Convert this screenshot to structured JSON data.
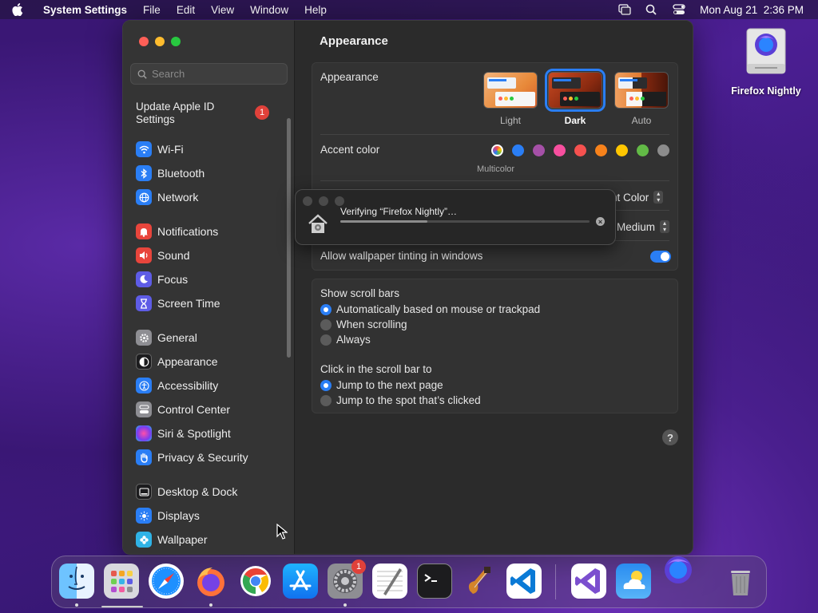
{
  "menubar": {
    "app_name": "System Settings",
    "menus": [
      "File",
      "Edit",
      "View",
      "Window",
      "Help"
    ],
    "datetime": "Mon Aug 21  2:36 PM"
  },
  "window": {
    "search": {
      "placeholder": "Search"
    },
    "sidebar": {
      "apple_id_label": "Update Apple ID Settings",
      "apple_id_badge": "1",
      "items": [
        {
          "label": "Wi-Fi",
          "icon": "wifi-icon",
          "color": "#2a7ef5"
        },
        {
          "label": "Bluetooth",
          "icon": "bluetooth-icon",
          "color": "#2a7ef5"
        },
        {
          "label": "Network",
          "icon": "globe-icon",
          "color": "#2a7ef5"
        },
        {
          "label": "Notifications",
          "icon": "bell-icon",
          "color": "#e8453c"
        },
        {
          "label": "Sound",
          "icon": "speaker-icon",
          "color": "#e8453c"
        },
        {
          "label": "Focus",
          "icon": "moon-icon",
          "color": "#5e5ce6"
        },
        {
          "label": "Screen Time",
          "icon": "hourglass-icon",
          "color": "#5e5ce6"
        },
        {
          "label": "General",
          "icon": "gear-icon",
          "color": "#8e8e93"
        },
        {
          "label": "Appearance",
          "icon": "appearance-icon",
          "color": "#1c1c1e"
        },
        {
          "label": "Accessibility",
          "icon": "accessibility-icon",
          "color": "#2a7ef5"
        },
        {
          "label": "Control Center",
          "icon": "control-center-icon",
          "color": "#8e8e93"
        },
        {
          "label": "Siri & Spotlight",
          "icon": "siri-icon",
          "color": "#b34fd1"
        },
        {
          "label": "Privacy & Security",
          "icon": "hand-icon",
          "color": "#2a7ef5"
        },
        {
          "label": "Desktop & Dock",
          "icon": "dock-icon",
          "color": "#1c1c1e"
        },
        {
          "label": "Displays",
          "icon": "sun-icon",
          "color": "#2a7ef5"
        },
        {
          "label": "Wallpaper",
          "icon": "flower-icon",
          "color": "#2fb3e6"
        }
      ]
    },
    "main": {
      "title": "Appearance",
      "appearance_label": "Appearance",
      "appearance_options": [
        {
          "label": "Light",
          "selected": false
        },
        {
          "label": "Dark",
          "selected": true
        },
        {
          "label": "Auto",
          "selected": false
        }
      ],
      "accent_label": "Accent color",
      "accent_colors": [
        "multicolor",
        "#2a7ef5",
        "#a550a7",
        "#f74f9e",
        "#f5514f",
        "#f7821b",
        "#ffc600",
        "#62ba46",
        "#8c8c8c"
      ],
      "accent_selected_label": "Multicolor",
      "highlight_value": "nt Color",
      "sidebar_icon_size_value": "Medium",
      "wallpaper_tinting_label": "Allow wallpaper tinting in windows",
      "wallpaper_tinting_on": true,
      "scroll_bars_label": "Show scroll bars",
      "scroll_bars_options": [
        {
          "label": "Automatically based on mouse or trackpad",
          "selected": true
        },
        {
          "label": "When scrolling",
          "selected": false
        },
        {
          "label": "Always",
          "selected": false
        }
      ],
      "click_label": "Click in the scroll bar to",
      "click_options": [
        {
          "label": "Jump to the next page",
          "selected": true
        },
        {
          "label": "Jump to the spot that’s clicked",
          "selected": false
        }
      ],
      "help_glyph": "?"
    }
  },
  "verify_dialog": {
    "text": "Verifying “Firefox Nightly”…",
    "progress": 0.35
  },
  "desktop_icon": {
    "label": "Firefox Nightly"
  },
  "dock": {
    "apps": [
      "Finder",
      "Launchpad",
      "Safari",
      "Firefox",
      "Chrome",
      "App Store",
      "System Settings",
      "TextEdit",
      "Terminal",
      "GarageBand",
      "Visual Studio Code",
      "Visual Studio",
      "Weather",
      "Firefox Nightly",
      "Trash"
    ],
    "system_settings_badge": "1"
  }
}
